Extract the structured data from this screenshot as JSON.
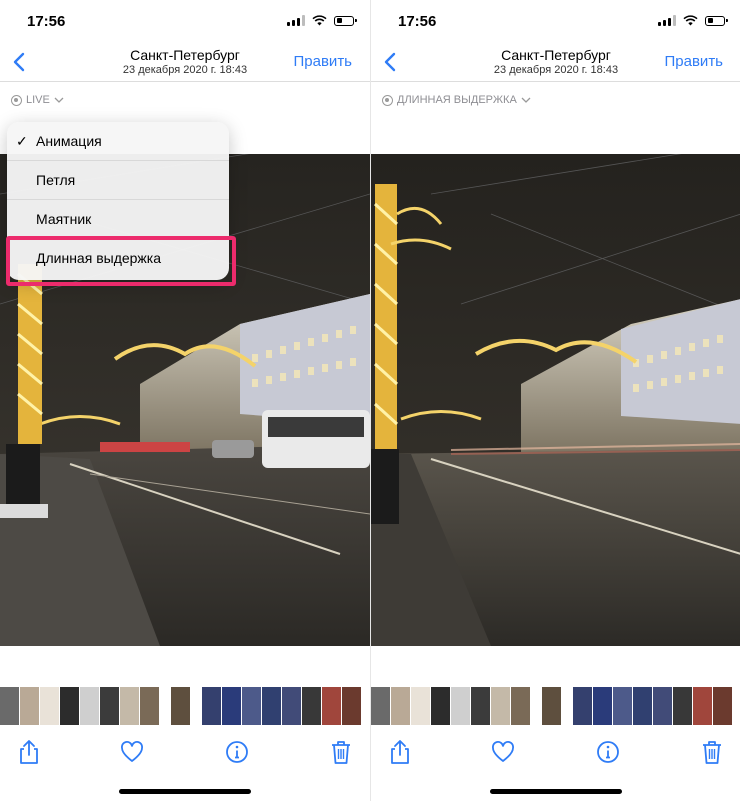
{
  "colors": {
    "accent": "#2f7cf6",
    "highlight": "#ec2b6c",
    "menu_bg": "#f6f6f6"
  },
  "left": {
    "status_time": "17:56",
    "title": "Санкт-Петербург",
    "subtitle": "23 декабря 2020 г.  18:43",
    "edit_label": "Править",
    "mode_label": "LIVE",
    "menu_items": [
      {
        "label": "Анимация",
        "checked": true
      },
      {
        "label": "Петля"
      },
      {
        "label": "Маятник"
      },
      {
        "label": "Длинная выдержка"
      }
    ],
    "menu_check": "✓"
  },
  "right": {
    "status_time": "17:56",
    "title": "Санкт-Петербург",
    "subtitle": "23 декабря 2020 г.  18:43",
    "edit_label": "Править",
    "mode_label": "ДЛИННАЯ ВЫДЕРЖКА"
  },
  "icons": {
    "back": "chevron-left-icon",
    "live": "live-photo-icon",
    "dropdown": "chevron-down-icon",
    "share": "share-icon",
    "favorite": "heart-icon",
    "info": "info-icon",
    "delete": "trash-icon"
  }
}
